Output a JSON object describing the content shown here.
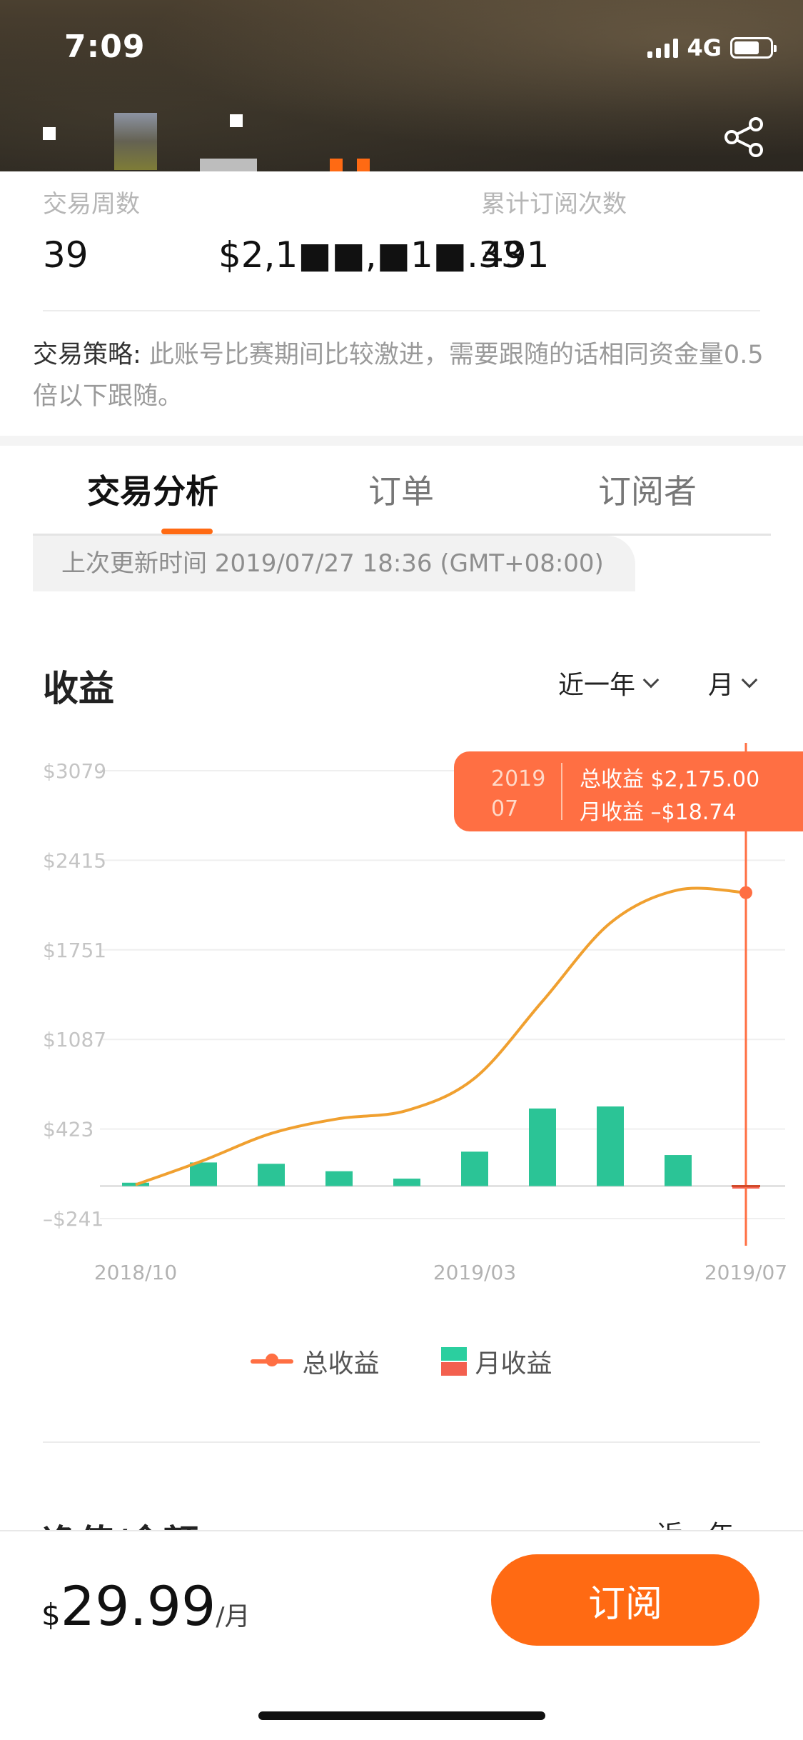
{
  "status_bar": {
    "time": "7:09",
    "network": "4G"
  },
  "stats": [
    {
      "label": "交易周数",
      "value": "39"
    },
    {
      "label": "",
      "value": "$2,1■■,■1■.33"
    },
    {
      "label": "累计订阅次数",
      "value": "491"
    }
  ],
  "strategy": {
    "label": "交易策略:",
    "text": " 此账号比赛期间比较激进，需要跟随的话相同资金量0.5倍以下跟随。"
  },
  "tabs": [
    {
      "label": "交易分析",
      "active": true
    },
    {
      "label": "订单",
      "active": false
    },
    {
      "label": "订阅者",
      "active": false
    }
  ],
  "update_text": "上次更新时间 2019/07/27 18:36 (GMT+08:00)",
  "income_section": {
    "title": "收益",
    "period_dropdown": "近一年",
    "granularity_dropdown": "月"
  },
  "tooltip": {
    "year": "2019",
    "month": "07",
    "total_line": "总收益 $2,175.00",
    "monthly_line": "月收益 –$18.74"
  },
  "chart_data": {
    "type": "bar+line",
    "y_tick_labels": [
      "$3079",
      "$2415",
      "$1751",
      "$1087",
      "$423",
      "–$241"
    ],
    "y_ticks": [
      3079,
      2415,
      1751,
      1087,
      423,
      -241
    ],
    "ylim": [
      -241,
      3079
    ],
    "x_tick_labels": [
      "2018/10",
      "2019/03",
      "2019/07"
    ],
    "categories": [
      "2018/10",
      "2018/11",
      "2018/12",
      "2019/01",
      "2019/02",
      "2019/03",
      "2019/04",
      "2019/05",
      "2019/06",
      "2019/07"
    ],
    "series": [
      {
        "name": "总收益",
        "kind": "line",
        "color": "#f0a030",
        "values": [
          10,
          190,
          390,
          500,
          560,
          800,
          1370,
          1950,
          2195,
          2175
        ]
      },
      {
        "name": "月收益",
        "kind": "bar",
        "color": "#2bc496",
        "values": [
          25,
          175,
          165,
          110,
          55,
          255,
          575,
          590,
          230,
          -18.74
        ]
      }
    ]
  },
  "legend": [
    {
      "label": "总收益"
    },
    {
      "label": "月收益"
    }
  ],
  "next_section": {
    "title": "净值/余额",
    "dropdown": "近一年"
  },
  "bottom_bar": {
    "currency": "$",
    "amount": "29.99",
    "unit": "/月",
    "subscribe_label": "订阅"
  },
  "colors": {
    "accent": "#ff6a13",
    "tooltip": "#ff6f43",
    "bar": "#2bc496",
    "line": "#f0a030"
  },
  "icons": {
    "share": "share-icon",
    "signal": "signal-icon",
    "battery": "battery-icon"
  }
}
